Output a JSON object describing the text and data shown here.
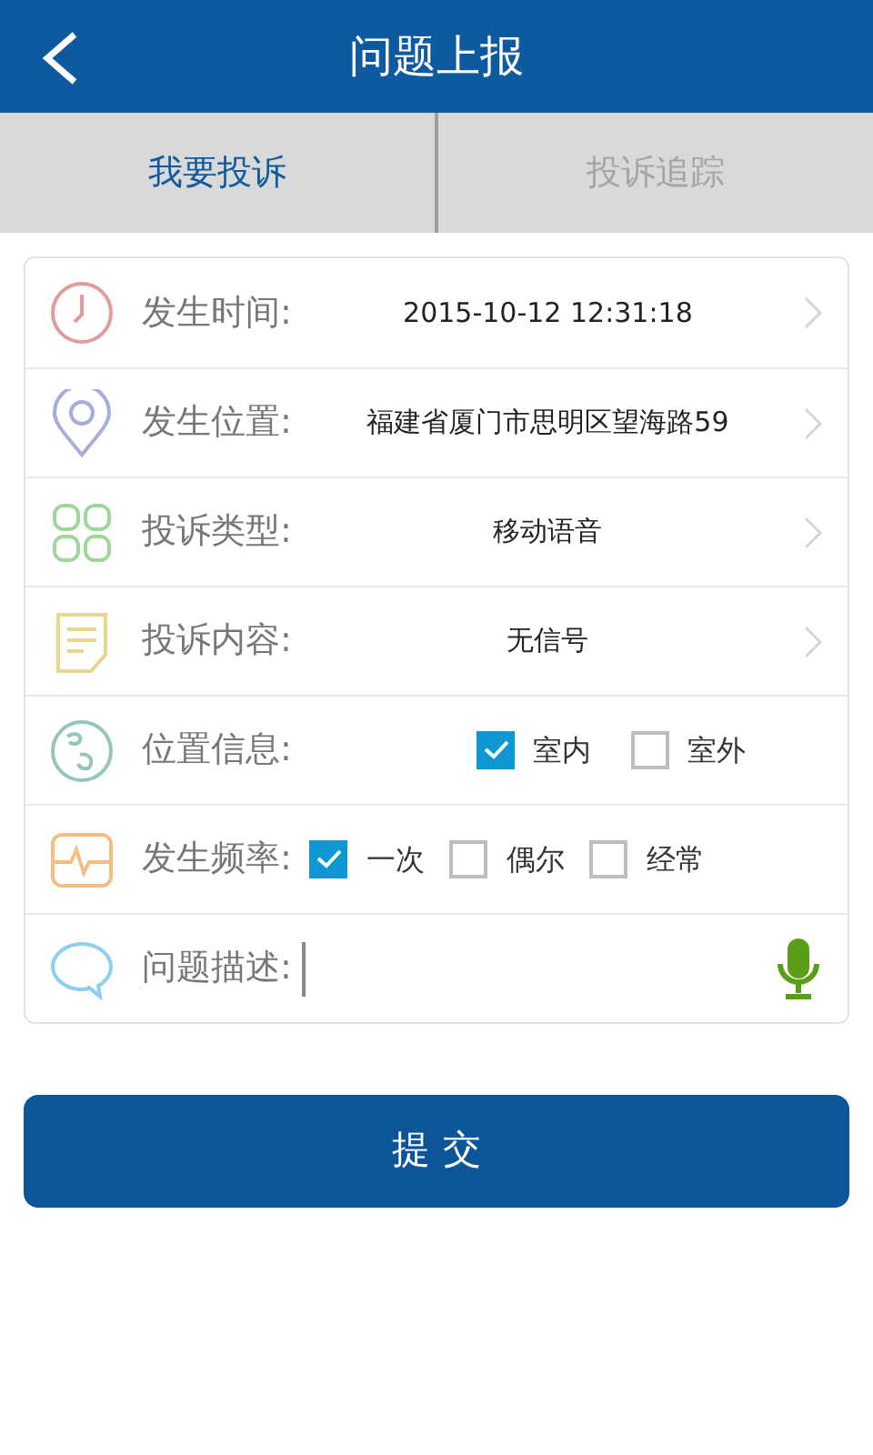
{
  "header": {
    "title": "问题上报"
  },
  "tabs": [
    {
      "label": "我要投诉",
      "selected": true
    },
    {
      "label": "投诉追踪",
      "selected": false
    }
  ],
  "form": {
    "rows": [
      {
        "kind": "select",
        "label": "发生时间:",
        "value": "2015-10-12 12:31:18"
      },
      {
        "kind": "select",
        "label": "发生位置:",
        "value": "福建省厦门市思明区望海路59"
      },
      {
        "kind": "select",
        "label": "投诉类型:",
        "value": "移动语音"
      },
      {
        "kind": "select",
        "label": "投诉内容:",
        "value": "无信号"
      },
      {
        "kind": "checks",
        "label": "位置信息:",
        "options": [
          {
            "label": "室内",
            "checked": true
          },
          {
            "label": "室外",
            "checked": false
          }
        ]
      },
      {
        "kind": "checks",
        "label": "发生频率:",
        "options": [
          {
            "label": "一次",
            "checked": true
          },
          {
            "label": "偶尔",
            "checked": false
          },
          {
            "label": "经常",
            "checked": false
          }
        ]
      },
      {
        "kind": "text",
        "label": "问题描述:"
      }
    ]
  },
  "submit": {
    "label": "提 交"
  }
}
